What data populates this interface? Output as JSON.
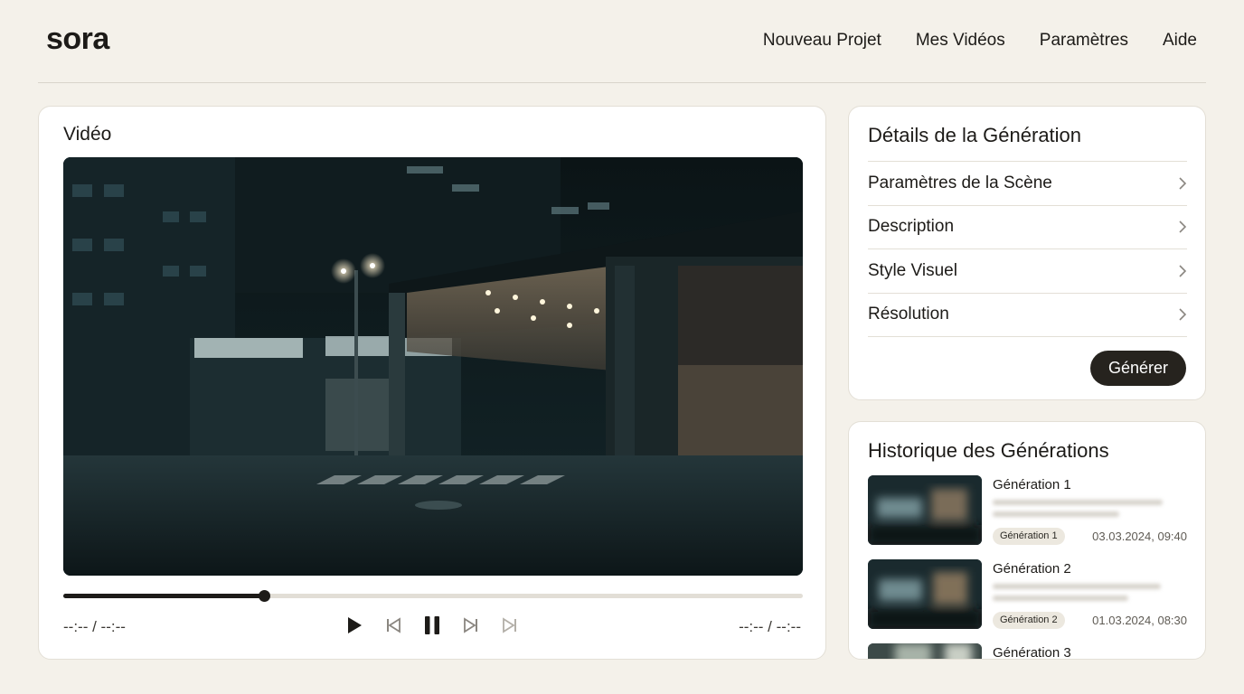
{
  "brand": {
    "logo": "sora"
  },
  "nav": {
    "items": [
      {
        "label": "Nouveau Projet"
      },
      {
        "label": "Mes Vidéos"
      },
      {
        "label": "Paramètres"
      },
      {
        "label": "Aide"
      }
    ]
  },
  "video": {
    "title": "Vidéo",
    "progress_fraction": 0.272,
    "time_elapsed": "--:-- / --:--",
    "time_total": "--:-- / --:--",
    "controls": [
      "play-icon",
      "skip-back-icon",
      "pause-icon",
      "skip-forward-icon",
      "skip-end-icon"
    ]
  },
  "details": {
    "title": "Détails de la Génération",
    "items": [
      {
        "label": "Paramètres de la Scène"
      },
      {
        "label": "Description"
      },
      {
        "label": "Style Visuel"
      },
      {
        "label": "Résolution"
      }
    ],
    "generate_label": "Générer"
  },
  "history": {
    "title": "Historique des Générations",
    "items": [
      {
        "name": "Génération 1",
        "badge": "Génération 1",
        "date": "03.03.2024, 09:40"
      },
      {
        "name": "Génération 2",
        "badge": "Génération 2",
        "date": "01.03.2024, 08:30"
      },
      {
        "name": "Génération 3"
      }
    ]
  },
  "colors": {
    "accent": "#26231e",
    "background": "#f4f1ea",
    "card": "#ffffff"
  }
}
